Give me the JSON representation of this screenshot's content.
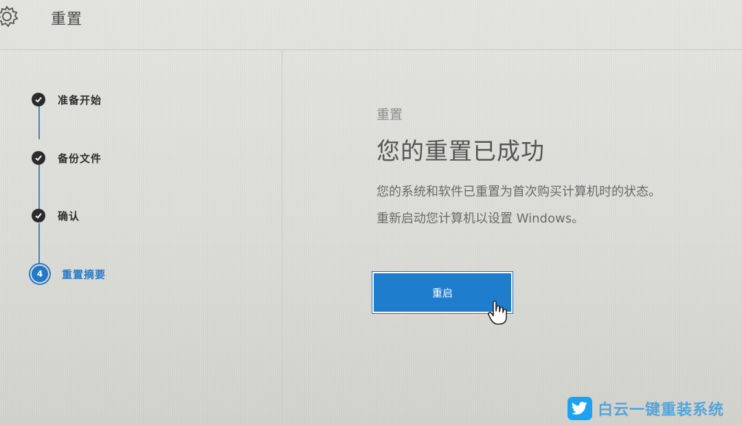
{
  "header": {
    "title": "重置",
    "icon": "gear-icon"
  },
  "steps": [
    {
      "label": "准备开始",
      "status": "completed",
      "icon": "check-icon"
    },
    {
      "label": "备份文件",
      "status": "completed",
      "icon": "check-icon"
    },
    {
      "label": "确认",
      "status": "completed",
      "icon": "check-icon"
    },
    {
      "label": "重置摘要",
      "status": "active",
      "number": "4"
    }
  ],
  "main": {
    "section_label": "重置",
    "headline": "您的重置已成功",
    "desc_line1": "您的系统和软件已重置为首次购买计算机时的状态。",
    "desc_line2": "重新启动您计算机以设置 Windows。",
    "restart_label": "重启"
  },
  "watermark": {
    "text": "白云一键重装系统"
  },
  "colors": {
    "accent": "#2378c7",
    "button": "#1f7dce",
    "background": "#dcdcd8"
  }
}
